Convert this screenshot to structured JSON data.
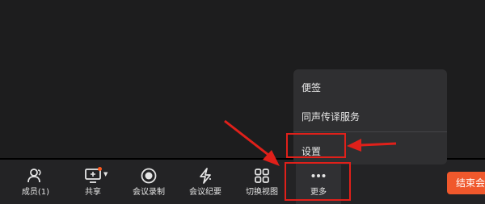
{
  "toolbar": {
    "members_label": "成员(1)",
    "share_label": "共享",
    "record_label": "会议录制",
    "minutes_label": "会议纪要",
    "switch_view_label": "切换视图",
    "more_label": "更多"
  },
  "end_button_label": "结束会",
  "more_menu": {
    "items": [
      "便签",
      "同声传译服务",
      "设置"
    ]
  },
  "colors": {
    "background": "#1d1d1e",
    "toolbar": "#232325",
    "menu": "#2f2f31",
    "end_button": "#f0582c",
    "annotation": "#e0201a"
  }
}
